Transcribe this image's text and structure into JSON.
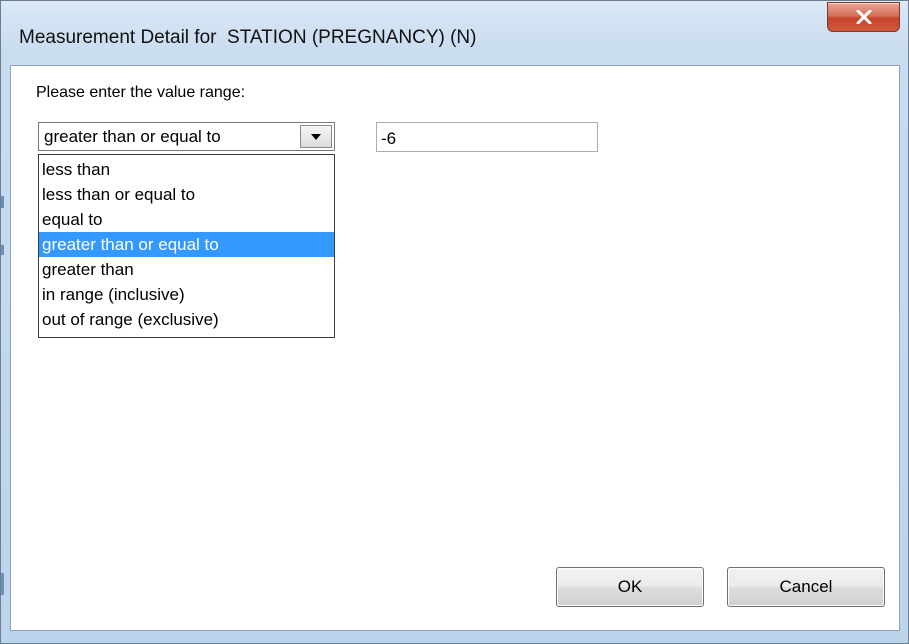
{
  "window": {
    "title": "Measurement Detail for  STATION (PREGNANCY) (N)",
    "close_icon": "close-x-icon"
  },
  "form": {
    "prompt": "Please enter the value range:",
    "operator_selected": "greater than or equal to",
    "operator_options": [
      "less than",
      "less than or equal to",
      "equal to",
      "greater than or equal to",
      "greater than",
      "in range (inclusive)",
      "out of range (exclusive)"
    ],
    "selected_index": 3,
    "value": "-6"
  },
  "buttons": {
    "ok_label": "OK",
    "cancel_label": "Cancel"
  },
  "colors": {
    "selection_highlight": "#3399ff",
    "close_button": "#c4442a"
  }
}
